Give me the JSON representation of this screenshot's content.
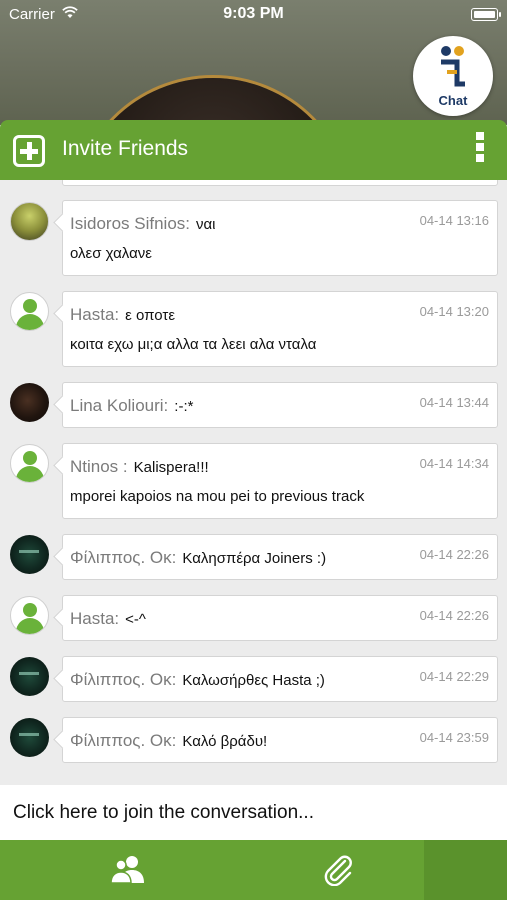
{
  "status_bar": {
    "carrier": "Carrier",
    "time": "9:03 PM",
    "icons": [
      "wifi-icon",
      "battery-icon"
    ]
  },
  "chat_badge": {
    "label": "Chat",
    "icon": "chat-logo-icon"
  },
  "toolbar": {
    "title": "Invite Friends",
    "left_icon": "add-square-icon",
    "right_icon": "more-vertical-icon",
    "color": "#66a233"
  },
  "messages": [
    {
      "author": "Isidoros Sifnios:",
      "text": "ναι",
      "line2": "ολεσ χαλανε",
      "time": "04-14 13:16",
      "avatar": "photo"
    },
    {
      "author": "Hasta:",
      "text": "ε οποτε",
      "line2": "κοιτα εχω μι;α αλλα τα λεει αλα νταλα",
      "time": "04-14 13:20",
      "avatar": "default"
    },
    {
      "author": "Lina Koliouri:",
      "text": ":-:*",
      "line2": "",
      "time": "04-14 13:44",
      "avatar": "photo"
    },
    {
      "author": "Ntinos :",
      "text": "Kalispera!!!",
      "line2": "mporei kapoios na mou pei to previous track",
      "time": "04-14 14:34",
      "avatar": "default"
    },
    {
      "author": "Φίλιππος. Οκ:",
      "text": "Καλησπέρα Joiners :)",
      "line2": "",
      "time": "04-14 22:26",
      "avatar": "photo"
    },
    {
      "author": "Hasta:",
      "text": "<-^",
      "line2": "",
      "time": "04-14 22:26",
      "avatar": "default"
    },
    {
      "author": "Φίλιππος. Οκ:",
      "text": "Καλωσήρθες Hasta ;)",
      "line2": "",
      "time": "04-14 22:29",
      "avatar": "photo"
    },
    {
      "author": "Φίλιππος. Οκ:",
      "text": "Καλό βράδυ!",
      "line2": "",
      "time": "04-14 23:59",
      "avatar": "photo"
    }
  ],
  "composer": {
    "placeholder": "Click here to join the conversation..."
  },
  "tabbar": {
    "items": [
      {
        "icon": "people-icon",
        "selected": false
      },
      {
        "icon": "paperclip-icon",
        "selected": false
      }
    ],
    "color": "#66a233"
  }
}
